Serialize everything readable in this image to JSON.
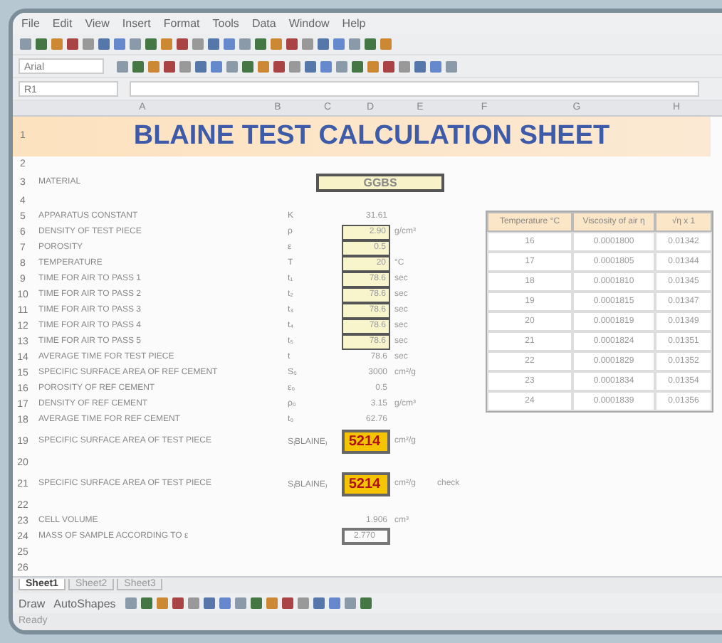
{
  "menu": [
    "File",
    "Edit",
    "View",
    "Insert",
    "Format",
    "Tools",
    "Data",
    "Window",
    "Help"
  ],
  "font_box": {
    "value": "Arial"
  },
  "name_box": {
    "value": "R1"
  },
  "columns": [
    "A",
    "B",
    "C",
    "D",
    "E",
    "F",
    "G",
    "H"
  ],
  "title_row": "1",
  "title": "BLAINE TEST CALCULATION SHEET",
  "rows": [
    {
      "num": "2",
      "kind": "blank"
    },
    {
      "num": "3",
      "kind": "material",
      "label": "MATERIAL",
      "value": "GGBS"
    },
    {
      "num": "4",
      "kind": "blank"
    },
    {
      "num": "5",
      "kind": "plain",
      "label": "APPARATUS CONSTANT",
      "symbol": "K",
      "value": "31.61",
      "unit": ""
    },
    {
      "num": "6",
      "kind": "input",
      "label": "DENSITY OF TEST PIECE",
      "symbol": "ρ",
      "value": "2.90",
      "unit": "g/cm³"
    },
    {
      "num": "7",
      "kind": "input",
      "label": "POROSITY",
      "symbol": "ε",
      "value": "0.5",
      "unit": ""
    },
    {
      "num": "8",
      "kind": "input",
      "label": "TEMPERATURE",
      "symbol": "T",
      "value": "20",
      "unit": "°C"
    },
    {
      "num": "9",
      "kind": "input",
      "label": "TIME FOR AIR TO PASS 1",
      "symbol": "t₁",
      "value": "78.6",
      "unit": "sec"
    },
    {
      "num": "10",
      "kind": "input",
      "label": "TIME FOR AIR TO PASS 2",
      "symbol": "t₂",
      "value": "78.6",
      "unit": "sec"
    },
    {
      "num": "11",
      "kind": "input",
      "label": "TIME FOR AIR TO PASS 3",
      "symbol": "t₃",
      "value": "78.6",
      "unit": "sec"
    },
    {
      "num": "12",
      "kind": "input",
      "label": "TIME FOR AIR TO PASS 4",
      "symbol": "t₄",
      "value": "78.6",
      "unit": "sec"
    },
    {
      "num": "13",
      "kind": "input",
      "label": "TIME FOR AIR TO PASS 5",
      "symbol": "t₅",
      "value": "78.6",
      "unit": "sec"
    },
    {
      "num": "14",
      "kind": "plain",
      "label": "AVERAGE TIME FOR TEST PIECE",
      "symbol": "t",
      "value": "78.6",
      "unit": "sec"
    },
    {
      "num": "15",
      "kind": "plain",
      "label": "SPECIFIC SURFACE AREA OF REF CEMENT",
      "symbol": "S₀",
      "value": "3000",
      "unit": "cm²/g"
    },
    {
      "num": "16",
      "kind": "plain",
      "label": "POROSITY OF REF CEMENT",
      "symbol": "ε₀",
      "value": "0.5",
      "unit": ""
    },
    {
      "num": "17",
      "kind": "plain",
      "label": "DENSITY OF REF CEMENT",
      "symbol": "ρ₀",
      "value": "3.15",
      "unit": "g/cm³"
    },
    {
      "num": "18",
      "kind": "plain",
      "label": "AVERAGE TIME FOR REF CEMENT",
      "symbol": "t₀",
      "value": "62.76",
      "unit": ""
    },
    {
      "num": "19",
      "kind": "result",
      "label": "SPECIFIC SURFACE AREA OF TEST PIECE",
      "symbol": "S₍BLAINE₎",
      "value": "5214",
      "unit": "cm²/g"
    },
    {
      "num": "20",
      "kind": "blank"
    },
    {
      "num": "21",
      "kind": "result",
      "label": "SPECIFIC SURFACE AREA OF TEST PIECE",
      "symbol": "S₍BLAINE₎",
      "value": "5214",
      "unit": "cm²/g",
      "note": "check"
    },
    {
      "num": "22",
      "kind": "blank"
    },
    {
      "num": "23",
      "kind": "plain",
      "label": "CELL VOLUME",
      "symbol": "",
      "value": "1.906",
      "unit": "cm³"
    },
    {
      "num": "24",
      "kind": "boxed",
      "label": "MASS OF SAMPLE ACCORDING TO ε",
      "symbol": "",
      "value": "2.770",
      "unit": ""
    },
    {
      "num": "25",
      "kind": "blank"
    },
    {
      "num": "26",
      "kind": "blank"
    }
  ],
  "viscosity_table": {
    "columns": [
      "Temperature °C",
      "Viscosity of air η",
      "√η x 1"
    ],
    "rows": [
      [
        "16",
        "0.0001800",
        "0.01342"
      ],
      [
        "17",
        "0.0001805",
        "0.01344"
      ],
      [
        "18",
        "0.0001810",
        "0.01345"
      ],
      [
        "19",
        "0.0001815",
        "0.01347"
      ],
      [
        "20",
        "0.0001819",
        "0.01349"
      ],
      [
        "21",
        "0.0001824",
        "0.01351"
      ],
      [
        "22",
        "0.0001829",
        "0.01352"
      ],
      [
        "23",
        "0.0001834",
        "0.01354"
      ],
      [
        "24",
        "0.0001839",
        "0.01356"
      ]
    ]
  },
  "sheet_tabs": [
    {
      "label": "Sheet1",
      "selected": true
    },
    {
      "label": "Sheet2",
      "selected": false
    },
    {
      "label": "Sheet3",
      "selected": false
    }
  ],
  "drawing_toolbar": {
    "draw": "Draw",
    "autoshapes": "AutoShapes"
  },
  "status_bar": "Ready"
}
